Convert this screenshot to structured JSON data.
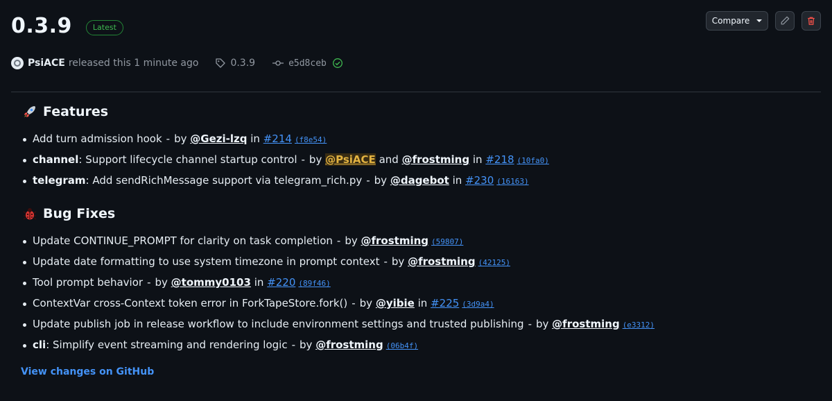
{
  "release": {
    "title": "0.3.9",
    "badge": "Latest",
    "author": "PsiACE",
    "released_text": "released this 1 minute ago",
    "tag": "0.3.9",
    "commit": "e5d8ceb"
  },
  "actions": {
    "compare_label": "Compare"
  },
  "features": {
    "title": "Features",
    "items": [
      {
        "kw": "",
        "text": "Add turn admission hook",
        "by": "by",
        "user": "@Gezi-lzq",
        "in": "in",
        "pr": "#214",
        "sha": "(f8e54)"
      },
      {
        "kw": "channel",
        "text": ": Support lifecycle channel startup control",
        "by": "by",
        "user": "@PsiACE",
        "and": "and",
        "user2": "@frostming",
        "in": "in",
        "pr": "#218",
        "sha": "(10fa0)"
      },
      {
        "kw": "telegram",
        "text": ": Add sendRichMessage support via telegram_rich.py",
        "by": "by",
        "user": "@dagebot",
        "in": "in",
        "pr": "#230",
        "sha": "(16163)"
      }
    ]
  },
  "bugfixes": {
    "title": "Bug Fixes",
    "items": [
      {
        "text": "Update CONTINUE_PROMPT for clarity on task completion",
        "by": "by",
        "user": "@frostming",
        "sha": "(59807)"
      },
      {
        "text": "Update date formatting to use system timezone in prompt context",
        "by": "by",
        "user": "@frostming",
        "sha": "(42125)"
      },
      {
        "text": "Tool prompt behavior",
        "by": "by",
        "user": "@tommy0103",
        "in": "in",
        "pr": "#220",
        "sha": "(89f46)"
      },
      {
        "text": "ContextVar cross-Context token error in ForkTapeStore.fork()",
        "by": "by",
        "user": "@yibie",
        "in": "in",
        "pr": "#225",
        "sha": "(3d9a4)"
      },
      {
        "text": "Update publish job in release workflow to include environment settings and trusted publishing",
        "by": "by",
        "user": "@frostming",
        "sha": "(e3312)"
      },
      {
        "kw": "cli",
        "text": ": Simplify event streaming and rendering logic",
        "by": "by",
        "user": "@frostming",
        "sha": "(06b4f)"
      }
    ]
  },
  "footer": {
    "link": "View changes on GitHub"
  },
  "separator": "-",
  "colors": {
    "background": "#0d1117",
    "link": "#4493f8",
    "badge": "#3fb950",
    "highlight": "#e3b341",
    "danger": "#f85149"
  },
  "icons": [
    "tag-icon",
    "commit-icon",
    "verified-check-icon",
    "rocket-icon",
    "bug-icon",
    "pencil-icon",
    "trash-icon",
    "caret-down-icon"
  ]
}
